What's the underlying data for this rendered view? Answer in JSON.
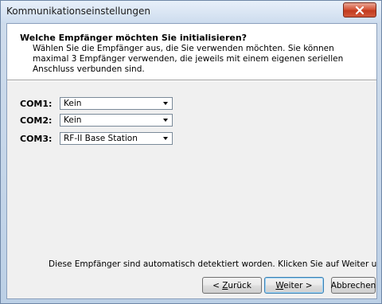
{
  "window": {
    "title": "Kommunikationseinstellungen"
  },
  "header": {
    "title": "Welche Empfänger möchten Sie initialisieren?",
    "description": "Wählen Sie die Empfänger aus, die Sie verwenden möchten. Sie können maximal 3 Empfänger verwenden, die jeweils mit einem eigenen seriellen Anschluss verbunden sind."
  },
  "ports": [
    {
      "label": "COM1:",
      "value": "Kein"
    },
    {
      "label": "COM2:",
      "value": "Kein"
    },
    {
      "label": "COM3:",
      "value": "RF-II Base Station"
    }
  ],
  "status": "Diese Empfänger sind automatisch detektiert worden. Klicken Sie auf Weiter um fortzufahren.",
  "buttons": {
    "back": {
      "pre": "< ",
      "mnemonic": "Z",
      "post": "urück"
    },
    "next": {
      "mnemonic": "W",
      "post": "eiter >"
    },
    "cancel": "Abbrechen"
  },
  "icons": {
    "close": "close-icon",
    "dropdown": "chevron-down-icon"
  },
  "colors": {
    "close_button": "#c23b1e",
    "default_button_border": "#3c7fb1"
  }
}
